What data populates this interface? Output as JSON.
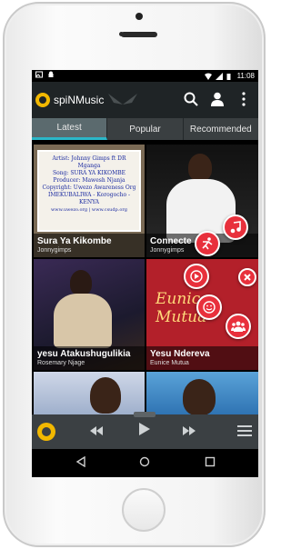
{
  "status": {
    "time": "11:08"
  },
  "app": {
    "title": "spiNMusic"
  },
  "tabs": [
    "Latest",
    "Popular",
    "Recommended"
  ],
  "cards": [
    {
      "title": "Sura Ya Kikombe",
      "artist": "Jonnygimps",
      "poster_lines": [
        "Artist: Johnny Gimps ft DR Mganga",
        "Song: SURA YA KIKOMBE",
        "Producer: Mawesh Njanja",
        "Copyright: Uwezo Awareness Org",
        "IMEKUBALIWA - Korogocho - KENYA",
        "www.uwezo.org | www.csudp.org"
      ]
    },
    {
      "title": "Connecte",
      "artist": "Jonnygimps"
    },
    {
      "title": "yesu Atakushugulikia",
      "artist": "Rosemary Njage"
    },
    {
      "title": "Yesu Ndereva",
      "artist": "Eunice Mutua",
      "brand_text": "Eunice Mutua"
    },
    {
      "title": "",
      "artist": ""
    },
    {
      "title": "",
      "artist": ""
    }
  ],
  "colors": {
    "accent": "#2bb7c9",
    "fab": "#e8303c",
    "logo": "#f2b800"
  }
}
